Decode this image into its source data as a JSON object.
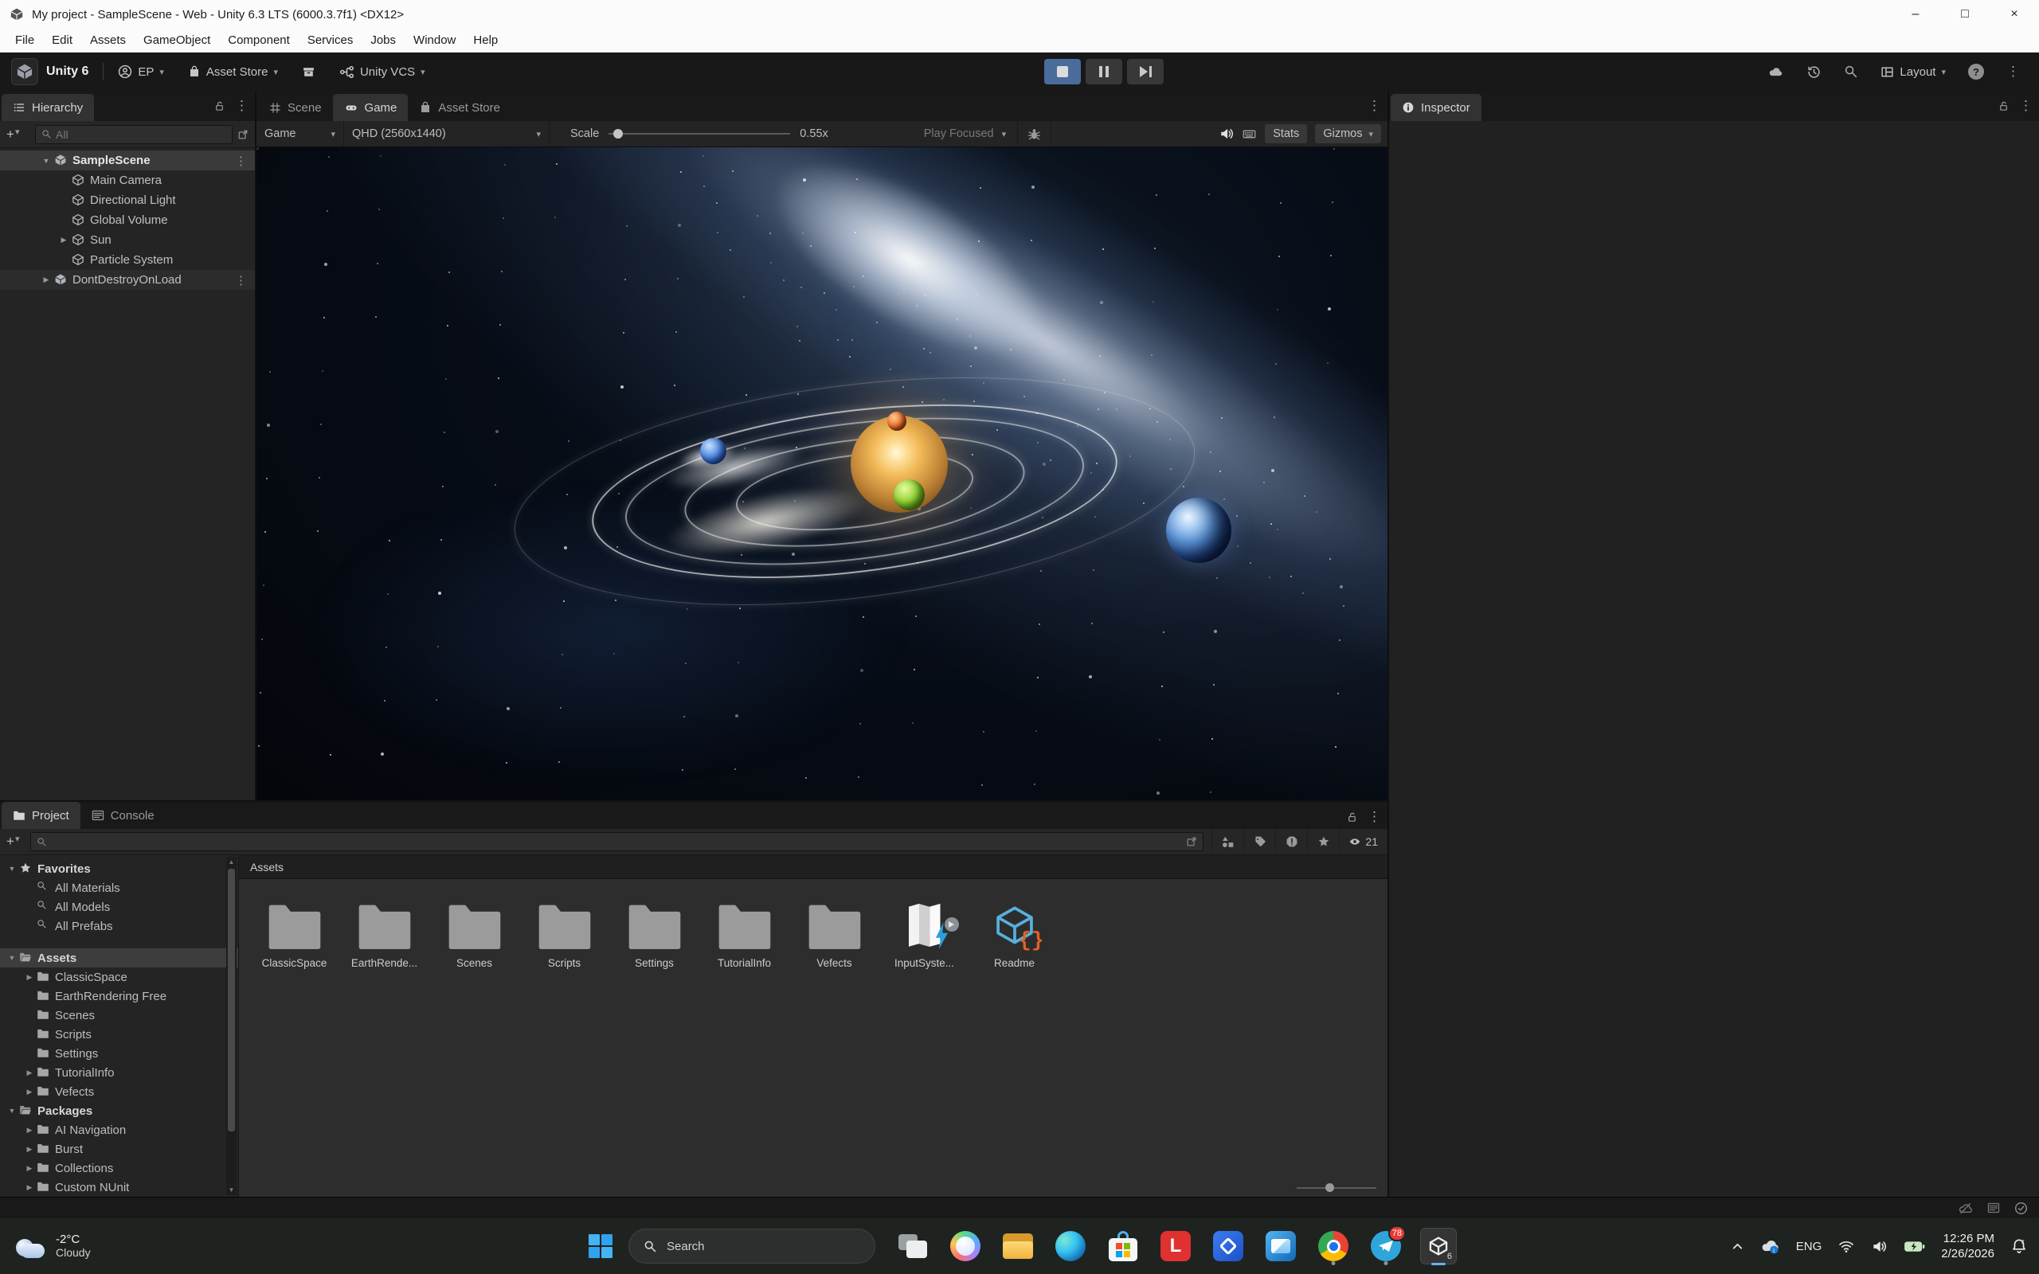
{
  "window": {
    "title": "My project - SampleScene - Web - Unity 6.3 LTS (6000.3.7f1) <DX12>"
  },
  "menu": {
    "items": [
      "File",
      "Edit",
      "Assets",
      "GameObject",
      "Component",
      "Services",
      "Jobs",
      "Window",
      "Help"
    ]
  },
  "toolbar": {
    "brand": "Unity 6",
    "account": "EP",
    "asset_store": "Asset Store",
    "vcs": "Unity VCS",
    "layout": "Layout"
  },
  "hierarchy": {
    "tab": "Hierarchy",
    "search_placeholder": "All",
    "items": [
      {
        "label": "SampleScene",
        "depth": 1,
        "arrow": "expanded",
        "icon": "scene",
        "selected": true,
        "kebab": true
      },
      {
        "label": "Main Camera",
        "depth": 2,
        "arrow": "none",
        "icon": "cube"
      },
      {
        "label": "Directional Light",
        "depth": 2,
        "arrow": "none",
        "icon": "cube"
      },
      {
        "label": "Global Volume",
        "depth": 2,
        "arrow": "none",
        "icon": "cube"
      },
      {
        "label": "Sun",
        "depth": 2,
        "arrow": "collapsed",
        "icon": "cube"
      },
      {
        "label": "Particle System",
        "depth": 2,
        "arrow": "none",
        "icon": "cube"
      },
      {
        "label": "DontDestroyOnLoad",
        "depth": 1,
        "arrow": "collapsed",
        "icon": "scene",
        "header": true,
        "kebab": true
      }
    ]
  },
  "game": {
    "tabs": [
      {
        "label": "Scene",
        "icon": "grid",
        "active": false
      },
      {
        "label": "Game",
        "icon": "gamepad",
        "active": true
      },
      {
        "label": "Asset Store",
        "icon": "bag",
        "active": false
      }
    ],
    "display": "Game",
    "resolution": "QHD (2560x1440)",
    "scale_label": "Scale",
    "scale_value": "0.55x",
    "play_focused": "Play Focused",
    "stats": "Stats",
    "gizmos": "Gizmos"
  },
  "inspector": {
    "tab": "Inspector"
  },
  "project": {
    "tab_project": "Project",
    "tab_console": "Console",
    "eye_count": "21",
    "assets_header": "Assets",
    "tree": [
      {
        "label": "Favorites",
        "depth": 0,
        "arrow": "expanded",
        "icon": "star",
        "bold": true
      },
      {
        "label": "All Materials",
        "depth": 1,
        "arrow": "none",
        "icon": "search"
      },
      {
        "label": "All Models",
        "depth": 1,
        "arrow": "none",
        "icon": "search"
      },
      {
        "label": "All Prefabs",
        "depth": 1,
        "arrow": "none",
        "icon": "search"
      },
      {
        "spacer": true
      },
      {
        "label": "Assets",
        "depth": 0,
        "arrow": "expanded",
        "icon": "folder-open",
        "bold": true,
        "selected": true
      },
      {
        "label": "ClassicSpace",
        "depth": 1,
        "arrow": "collapsed",
        "icon": "folder"
      },
      {
        "label": "EarthRendering Free",
        "depth": 1,
        "arrow": "none",
        "icon": "folder"
      },
      {
        "label": "Scenes",
        "depth": 1,
        "arrow": "none",
        "icon": "folder"
      },
      {
        "label": "Scripts",
        "depth": 1,
        "arrow": "none",
        "icon": "folder"
      },
      {
        "label": "Settings",
        "depth": 1,
        "arrow": "none",
        "icon": "folder"
      },
      {
        "label": "TutorialInfo",
        "depth": 1,
        "arrow": "collapsed",
        "icon": "folder"
      },
      {
        "label": "Vefects",
        "depth": 1,
        "arrow": "collapsed",
        "icon": "folder"
      },
      {
        "label": "Packages",
        "depth": 0,
        "arrow": "expanded",
        "icon": "folder-open",
        "bold": true
      },
      {
        "label": "AI Navigation",
        "depth": 1,
        "arrow": "collapsed",
        "icon": "folder"
      },
      {
        "label": "Burst",
        "depth": 1,
        "arrow": "collapsed",
        "icon": "folder"
      },
      {
        "label": "Collections",
        "depth": 1,
        "arrow": "collapsed",
        "icon": "folder"
      },
      {
        "label": "Custom NUnit",
        "depth": 1,
        "arrow": "collapsed",
        "icon": "folder"
      }
    ],
    "assets": [
      {
        "label": "ClassicSpace",
        "kind": "folder"
      },
      {
        "label": "EarthRende...",
        "kind": "folder"
      },
      {
        "label": "Scenes",
        "kind": "folder"
      },
      {
        "label": "Scripts",
        "kind": "folder"
      },
      {
        "label": "Settings",
        "kind": "folder"
      },
      {
        "label": "TutorialInfo",
        "kind": "folder"
      },
      {
        "label": "Vefects",
        "kind": "folder"
      },
      {
        "label": "InputSyste...",
        "kind": "inputsystem"
      },
      {
        "label": "Readme",
        "kind": "readme"
      }
    ]
  },
  "taskbar": {
    "weather_temp": "-2°C",
    "weather_cond": "Cloudy",
    "search_placeholder": "Search",
    "apps": [
      {
        "name": "task-view"
      },
      {
        "name": "copilot"
      },
      {
        "name": "file-explorer"
      },
      {
        "name": "edge"
      },
      {
        "name": "microsoft-store"
      },
      {
        "name": "l-app"
      },
      {
        "name": "photos"
      },
      {
        "name": "outlook"
      },
      {
        "name": "chrome",
        "running": true
      },
      {
        "name": "telegram",
        "running": true,
        "badge": "78"
      },
      {
        "name": "unity-hub",
        "active": true
      }
    ],
    "tray": {
      "language": "ENG",
      "time": "12:26 PM",
      "date": "2/26/2026"
    }
  },
  "icons": {
    "minimize": "–",
    "maximize": "□",
    "close": "×",
    "chevron_down": "▾",
    "tree_expanded": "▼",
    "tree_collapsed": "▶",
    "kebab": "⋮",
    "plus": "+",
    "help": "?",
    "l_app_letter": "L",
    "unity_badge": "6"
  },
  "colors": {
    "playmode_accent": "#4a6c9b",
    "selection_gray": "#3d3d3d",
    "taskbar_badge": "#e53935"
  }
}
